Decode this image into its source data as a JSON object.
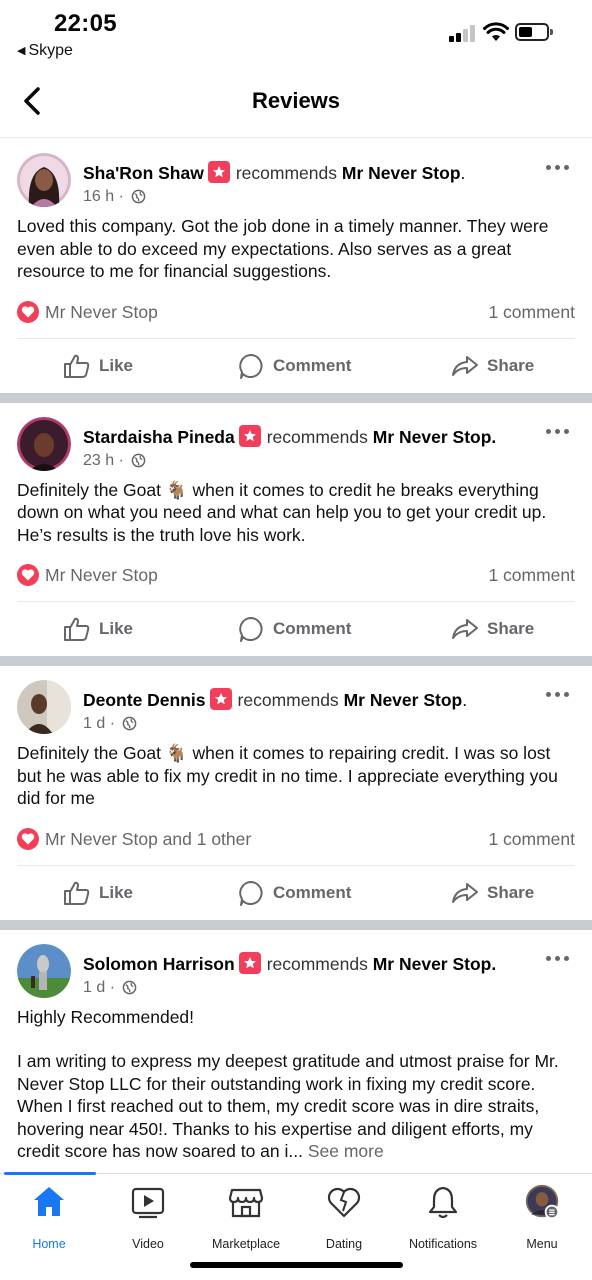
{
  "status_bar": {
    "time": "22:05",
    "back_app": "Skype"
  },
  "header": {
    "title": "Reviews"
  },
  "posts": [
    {
      "author": "Sha'Ron Shaw",
      "recommends_text": "recommends",
      "page_name": "Mr Never Stop",
      "time": "16 h",
      "text": "Loved this company. Got the job done in a timely manner. They were even able to do exceed my expectations. Also serves as a great resource to me for financial suggestions.",
      "reactions": "Mr Never Stop",
      "comments": "1 comment",
      "actions": {
        "like": "Like",
        "comment": "Comment",
        "share": "Share"
      }
    },
    {
      "author": "Stardaisha Pineda",
      "recommends_text": "recommends",
      "page_name": "Mr Never Stop.",
      "time": "23 h",
      "text": "Definitely the Goat 🐐 when it comes to credit he breaks everything down on what you need and what can help you to get your credit up. He’s results is the truth love his work.",
      "reactions": "Mr Never Stop",
      "comments": "1 comment",
      "actions": {
        "like": "Like",
        "comment": "Comment",
        "share": "Share"
      }
    },
    {
      "author": "Deonte Dennis",
      "recommends_text": "recommends",
      "page_name": "Mr Never Stop",
      "time": "1 d",
      "text": "Definitely the Goat 🐐 when it comes to repairing credit. I was so lost but he was able to fix my credit in no time. I appreciate everything you did for me",
      "reactions": "Mr Never Stop and 1 other",
      "comments": "1 comment",
      "actions": {
        "like": "Like",
        "comment": "Comment",
        "share": "Share"
      }
    },
    {
      "author": "Solomon Harrison",
      "recommends_text": "recommends",
      "page_name": "Mr Never Stop.",
      "time": "1 d",
      "text_title": "Highly Recommended!",
      "text": "I am writing to express my deepest gratitude and utmost praise for Mr. Never Stop LLC for their outstanding work in fixing my credit score. When I first reached out to them, my credit score was in dire straits, hovering near 450!. Thanks to his expertise and diligent efforts, my credit score has now soared to an i...",
      "see_more": "See more"
    }
  ],
  "tabs": [
    {
      "label": "Home",
      "icon": "home-icon",
      "active": true
    },
    {
      "label": "Video",
      "icon": "video-icon"
    },
    {
      "label": "Marketplace",
      "icon": "marketplace-icon"
    },
    {
      "label": "Dating",
      "icon": "dating-icon"
    },
    {
      "label": "Notifications",
      "icon": "bell-icon"
    },
    {
      "label": "Menu",
      "icon": "avatar"
    }
  ],
  "colors": {
    "accent": "#1877f2",
    "heart": "#f33e58",
    "recommend": "#f03e5c",
    "separator": "#c9ccd1"
  }
}
